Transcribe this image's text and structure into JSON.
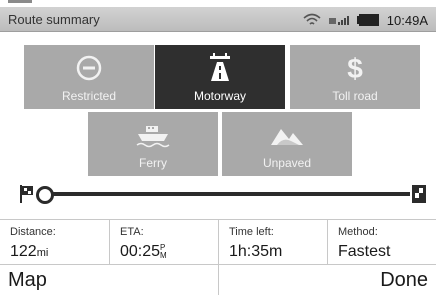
{
  "status_bar": {
    "title": "Route summary",
    "time": "10:49A"
  },
  "avoid_options": [
    {
      "label": "Restricted",
      "icon": "no-entry-icon",
      "selected": false
    },
    {
      "label": "Motorway",
      "icon": "motorway-icon",
      "selected": true
    },
    {
      "label": "Toll road",
      "icon": "dollar-icon",
      "selected": false
    },
    {
      "label": "Ferry",
      "icon": "ferry-icon",
      "selected": false
    },
    {
      "label": "Unpaved",
      "icon": "unpaved-icon",
      "selected": false
    }
  ],
  "route_progress": 0,
  "info": {
    "distance": {
      "label": "Distance:",
      "value": "122",
      "unit": "mi"
    },
    "eta": {
      "label": "ETA:",
      "value": "00:25",
      "unit_top": "P",
      "unit_bottom": "M"
    },
    "time_left": {
      "label": "Time left:",
      "value": "1h:35m"
    },
    "method": {
      "label": "Method:",
      "value": "Fastest"
    }
  },
  "bottom_bar": {
    "left_label": "Map",
    "right_label": "Done"
  },
  "colors": {
    "tile_default": "#a9a9a9",
    "tile_selected": "#2f2f2f"
  }
}
